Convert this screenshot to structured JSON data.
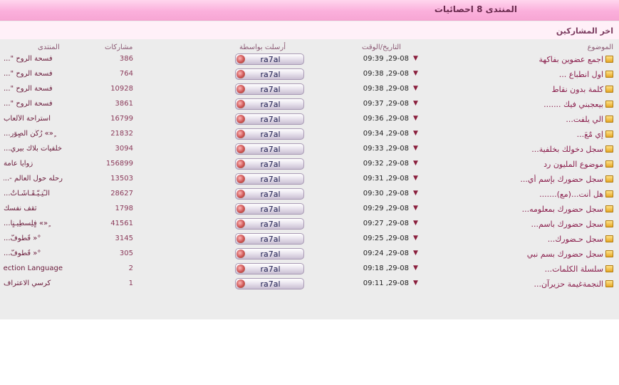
{
  "header": {
    "title": "المنتدى 8 احصائيات"
  },
  "section": {
    "title": "اخر المشاركين"
  },
  "columns": {
    "topic": "الموضوع",
    "date": "التاريخ/الوقت",
    "poster": "أرسلت بواسطة",
    "posts": "مشاركات",
    "forum": "المنتدى"
  },
  "rows": [
    {
      "topic": "اجمع عضوين بفاكهة",
      "date": "29-08, 09:39",
      "poster": "ra7al",
      "posts": "386",
      "forum": "فسحة الروح \"..."
    },
    {
      "topic": "اول انطباع ...",
      "date": "29-08, 09:38",
      "poster": "ra7al",
      "posts": "764",
      "forum": "فسحة الروح \"..."
    },
    {
      "topic": "كلمة بدون نقاط",
      "date": "29-08, 09:38",
      "poster": "ra7al",
      "posts": "10928",
      "forum": "فسحة الروح \"..."
    },
    {
      "topic": "بيعجبني فيك .......",
      "date": "29-08, 09:37",
      "poster": "ra7al",
      "posts": "3861",
      "forum": "فسحة الروح \"..."
    },
    {
      "topic": "الي يلفت...",
      "date": "29-08, 09:36",
      "poster": "ra7al",
      "posts": "16799",
      "forum": "استراحة الألعاب"
    },
    {
      "topic": "إيِ مٌعَ...",
      "date": "29-08, 09:34",
      "poster": "ra7al",
      "posts": "21832",
      "forum": "ٍ«» رُكُنٍ آلصٍوَرٍ..."
    },
    {
      "topic": "سجل دخولك بخلفية...",
      "date": "29-08, 09:33",
      "poster": "ra7al",
      "posts": "3094",
      "forum": "خلفيات بلاك بيري..."
    },
    {
      "topic": "موضوع المليون رد",
      "date": "29-08, 09:32",
      "poster": "ra7al",
      "posts": "156899",
      "forum": "زوايا عامة"
    },
    {
      "topic": "سجل حضورك بإسم أي...",
      "date": "29-08, 09:31",
      "poster": "ra7al",
      "posts": "13503",
      "forum": "رحله حول العالم -..."
    },
    {
      "topic": "هل أنت...(مع).......",
      "date": "29-08, 09:30",
      "poster": "ra7al",
      "posts": "28627",
      "forum": "الـًتِـيّـقَـآشَـآتٌ..."
    },
    {
      "topic": "سجل حضورك بمعلومه...",
      "date": "29-08, 09:29",
      "poster": "ra7al",
      "posts": "1798",
      "forum": "ثقف نفسك"
    },
    {
      "topic": "سجل حضورك باسم...",
      "date": "29-08, 09:27",
      "poster": "ra7al",
      "posts": "41561",
      "forum": "ٍ«» فٍلِسطِيـنٍآ..."
    },
    {
      "topic": "سجل حـضورك...",
      "date": "29-08, 09:25",
      "poster": "ra7al",
      "posts": "3145",
      "forum": "°« قُطُوفّ..."
    },
    {
      "topic": "سجل حضورك بسم نبي",
      "date": "29-08, 09:24",
      "poster": "ra7al",
      "posts": "305",
      "forum": "°« قُطُوفّ..."
    },
    {
      "topic": "سلسلة الكلمات...",
      "date": "29-08, 09:18",
      "poster": "ra7al",
      "posts": "2",
      "forum": "Section Language..."
    },
    {
      "topic": "النجمةغيمة حزيرآن...",
      "date": "29-08, 09:11",
      "poster": "ra7al",
      "posts": "1",
      "forum": "كرسي الاعتراف"
    }
  ]
}
